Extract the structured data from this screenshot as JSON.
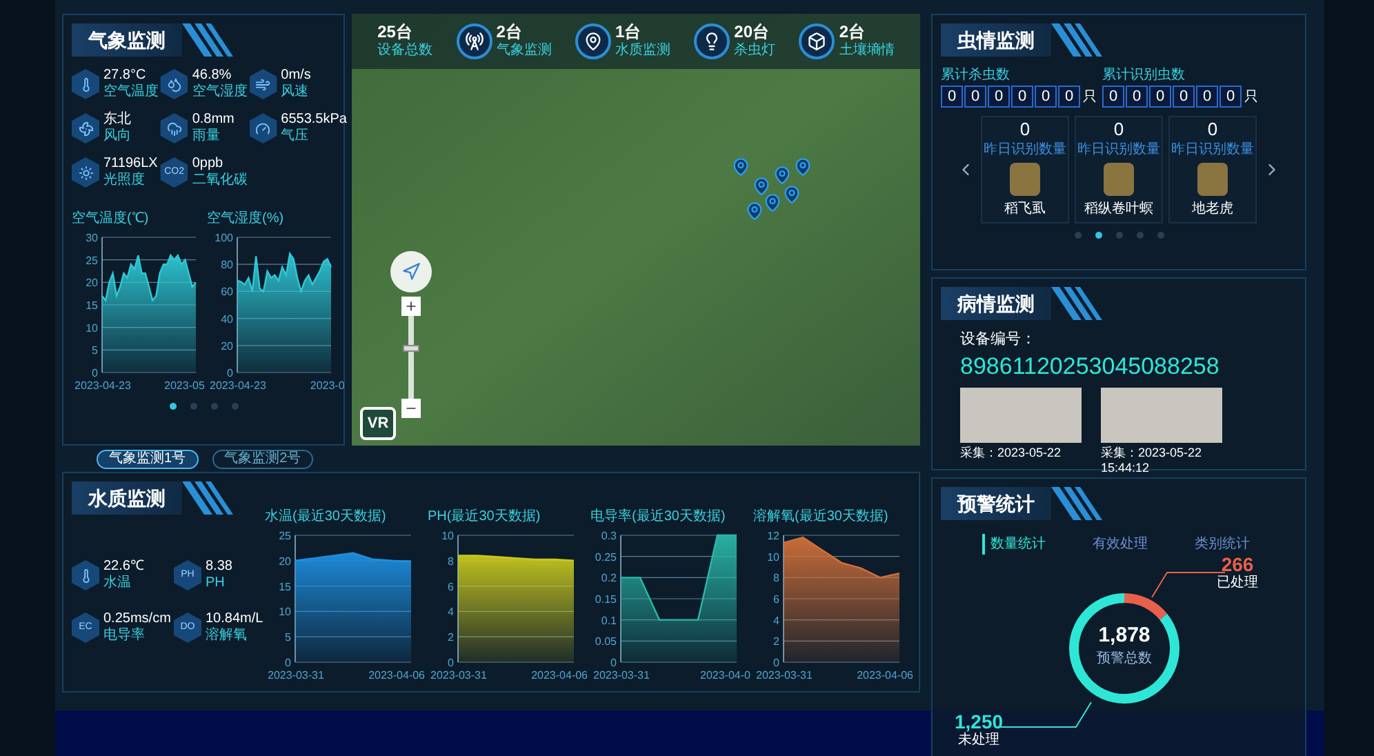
{
  "weather": {
    "title": "气象监测",
    "metrics": [
      {
        "value": "27.8°C",
        "label": "空气温度"
      },
      {
        "value": "46.8%",
        "label": "空气湿度"
      },
      {
        "value": "0m/s",
        "label": "风速"
      },
      {
        "value": "东北",
        "label": "风向"
      },
      {
        "value": "0.8mm",
        "label": "雨量"
      },
      {
        "value": "6553.5kPa",
        "label": "气压"
      },
      {
        "value": "71196LX",
        "label": "光照度"
      },
      {
        "badge": "CO2",
        "value": "0ppb",
        "label": "二氧化碳"
      }
    ],
    "charts": [
      {
        "title": "空气温度(℃)",
        "y_labels": [
          "30",
          "25",
          "20",
          "15",
          "10",
          "5",
          "0"
        ],
        "x_labels": [
          "2023-04-23",
          "2023-05"
        ]
      },
      {
        "title": "空气湿度(%)",
        "y_labels": [
          "100",
          "80",
          "60",
          "40",
          "20",
          "0"
        ],
        "x_labels": [
          "2023-04-23",
          "2023-0"
        ]
      }
    ],
    "pager": [
      {
        "selected": true
      },
      {
        "selected": false
      },
      {
        "selected": false
      },
      {
        "selected": false
      }
    ],
    "stations": [
      {
        "label": "气象监测1号",
        "selected": true
      },
      {
        "label": "气象监测2号",
        "selected": false
      }
    ]
  },
  "map": {
    "stats": [
      {
        "value": "25台",
        "label": "设备总数"
      },
      {
        "value": "2台",
        "label": "气象监测"
      },
      {
        "value": "1台",
        "label": "水质监测"
      },
      {
        "value": "20台",
        "label": "杀虫灯"
      },
      {
        "value": "2台",
        "label": "土壤墒情"
      }
    ],
    "zoom": {
      "level": 0.62
    },
    "vr": "VR"
  },
  "water": {
    "title": "水质监测",
    "metrics": [
      {
        "value": "22.6℃",
        "label": "水温"
      },
      {
        "badge": "PH",
        "value": "8.38",
        "label": "PH"
      },
      {
        "badge": "EC",
        "value": "0.25ms/cm",
        "label": "电导率"
      },
      {
        "badge": "DO",
        "value": "10.84m/L",
        "label": "溶解氧"
      }
    ],
    "charts": [
      {
        "title": "水温(最近30天数据)",
        "y_labels": [
          "25",
          "20",
          "15",
          "10",
          "5",
          "0"
        ],
        "x_labels": [
          "2023-03-31",
          "2023-04-06"
        ]
      },
      {
        "title": "PH(最近30天数据)",
        "y_labels": [
          "10",
          "8",
          "6",
          "4",
          "2",
          "0"
        ],
        "x_labels": [
          "2023-03-31",
          "2023-04-06"
        ]
      },
      {
        "title": "电导率(最近30天数据)",
        "y_labels": [
          "0.3",
          "0.25",
          "0.2",
          "0.15",
          "0.1",
          "0.05",
          "0"
        ],
        "x_labels": [
          "2023-03-31",
          "2023-04-0"
        ]
      },
      {
        "title": "溶解氧(最近30天数据)",
        "y_labels": [
          "12",
          "10",
          "8",
          "6",
          "4",
          "2",
          "0"
        ],
        "x_labels": [
          "2023-03-31",
          "2023-04-06"
        ]
      }
    ]
  },
  "insects": {
    "title": "虫情监测",
    "counters": [
      {
        "label": "累计杀虫数",
        "digits": [
          "0",
          "0",
          "0",
          "0",
          "0",
          "0"
        ],
        "unit": "只"
      },
      {
        "label": "累计识别虫数",
        "digits": [
          "0",
          "0",
          "0",
          "0",
          "0",
          "0"
        ],
        "unit": "只"
      }
    ],
    "cards": [
      {
        "count": "0",
        "label": "昨日识别数量",
        "name": "稻飞虱"
      },
      {
        "count": "0",
        "label": "昨日识别数量",
        "name": "稻纵卷叶螟"
      },
      {
        "count": "0",
        "label": "昨日识别数量",
        "name": "地老虎"
      }
    ],
    "pager": [
      {
        "selected": false
      },
      {
        "selected": true
      },
      {
        "selected": false
      },
      {
        "selected": false
      },
      {
        "selected": false
      }
    ]
  },
  "disease": {
    "title": "病情监测",
    "device_label": "设备编号：",
    "device_id": "89861120253045088258",
    "images": [
      {
        "caption": "采集：2023-05-22"
      },
      {
        "caption": "采集：2023-05-22 15:44:12"
      }
    ]
  },
  "warning": {
    "title": "预警统计",
    "tabs": [
      {
        "label": "数量统计",
        "selected": true
      },
      {
        "label": "有效处理",
        "selected": false
      },
      {
        "label": "类别统计",
        "selected": false
      }
    ],
    "total": "1,878",
    "total_label": "预警总数",
    "callouts": [
      {
        "value": "266",
        "label": "已处理",
        "color": "#e8604c"
      },
      {
        "value": "1,250",
        "label": "未处理",
        "color": "#2ee6d6"
      }
    ]
  }
}
